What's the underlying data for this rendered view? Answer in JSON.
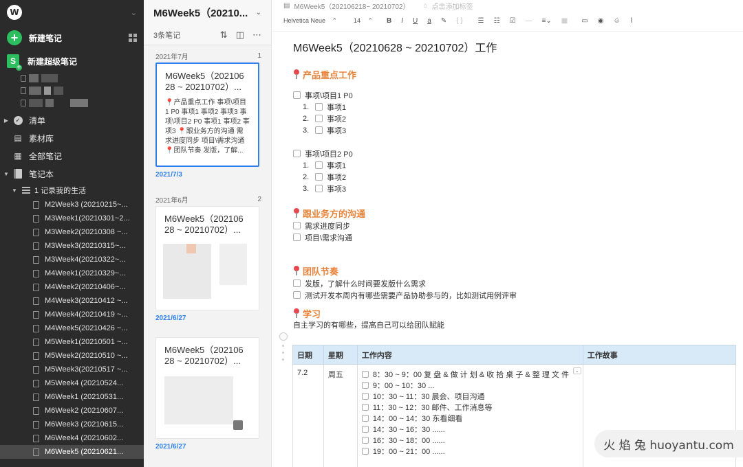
{
  "sidebar": {
    "logo_letter": "W",
    "new_note": "新建笔记",
    "new_super_note": "新建超级笔记",
    "items": [
      {
        "label": "清单",
        "icon": "checklist-icon"
      },
      {
        "label": "素材库",
        "icon": "library-icon"
      },
      {
        "label": "全部笔记",
        "icon": "all-notes-icon"
      },
      {
        "label": "笔记本",
        "icon": "notebook-icon"
      }
    ],
    "notebook_group": "1 记录我的生活",
    "notes": [
      "M2Week3 (20210215~...",
      "M3Week1(20210301~2...",
      "M3Week2(20210308 ~...",
      "M3Week3(20210315~...",
      "M3Week4(20210322~...",
      "M4Week1(20210329~...",
      "M4Week2(20210406~...",
      "M4Week3(20210412 ~...",
      "M4Week4(20210419 ~...",
      "M4Week5(20210426 ~...",
      "M5Week1(20210501 ~...",
      "M5Week2(20210510 ~...",
      "M5Week3(20210517 ~...",
      "M5Week4 (20210524...",
      "M6Week1 (20210531...",
      "M6Week2 (20210607...",
      "M6Week3 (20210615...",
      "M6Week4 (20210602...",
      "M6Week5 (20210621..."
    ]
  },
  "notelist": {
    "title": "M6Week5（20210...",
    "count": "3条笔记",
    "sections": [
      {
        "month": "2021年7月",
        "count": "1"
      },
      {
        "month": "2021年6月",
        "count": "2"
      }
    ],
    "cards": [
      {
        "title": "M6Week5（202106 28 ~ 20210702）...",
        "snippet": "📍产品重点工作 事项\\项目1 P0 事项1 事项2 事项3 事项\\项目2 P0 事项1 事项2 事项3 📍跟业务方的沟通 需求进度同步 项目\\需求沟通 📍团队节奏 发版，了解...",
        "date": "2021/7/3"
      },
      {
        "title": "M6Week5（202106 28 ~ 20210702）...",
        "snippet": "",
        "date": "2021/6/27"
      },
      {
        "title": "M6Week5（202106 28 ~ 20210702）...",
        "snippet": "",
        "date": "2021/6/27"
      }
    ]
  },
  "editor": {
    "breadcrumb": "M6Week5（20210621​8~ 20210702）",
    "add_tag": "点击添加标签",
    "font": "Helvetica Neue",
    "font_size": "14",
    "title": "M6Week5（20210628 ~ 20210702）工作",
    "sections": {
      "s1": "产品重点工作",
      "s2": "跟业务方的沟通",
      "s3": "团队节奏",
      "s4": "学习"
    },
    "project1": "事项\\项目1 P0",
    "project2": "事项\\项目2 P0",
    "sub": [
      "事项1",
      "事项2",
      "事项3"
    ],
    "nums": [
      "1.",
      "2.",
      "3."
    ],
    "comm": [
      "需求进度同步",
      "项目\\需求沟通"
    ],
    "team": [
      "发版，了解什么时间要发版什么需求",
      "测试开发本周内有哪些需要产品协助参与的，比如测试用例评审"
    ],
    "study": "自主学习的有哪些，提高自己可以给团队赋能",
    "table": {
      "headers": [
        "日期",
        "星期",
        "工作内容",
        "工作故事"
      ],
      "date": "7.2",
      "weekday": "周五",
      "tasks": [
        "8：30 ~ 9：00 复 盘 & 做 计 划 & 收 拾 桌 子 & 整 理 文 件",
        "9：00 ~ 10：30 ...",
        "10：30 ~ 11：30 晨会、项目沟通",
        "11：30 ~ 12：30 邮件、工作消息等",
        "14：00 ~ 14：30 东看细看",
        "14：30 ~ 16：30 ......",
        "16：30 ~ 18：00 ......",
        "19：00 ~ 21：00 ......"
      ]
    }
  },
  "watermark": "火 焰 兔  huoyantu.com"
}
